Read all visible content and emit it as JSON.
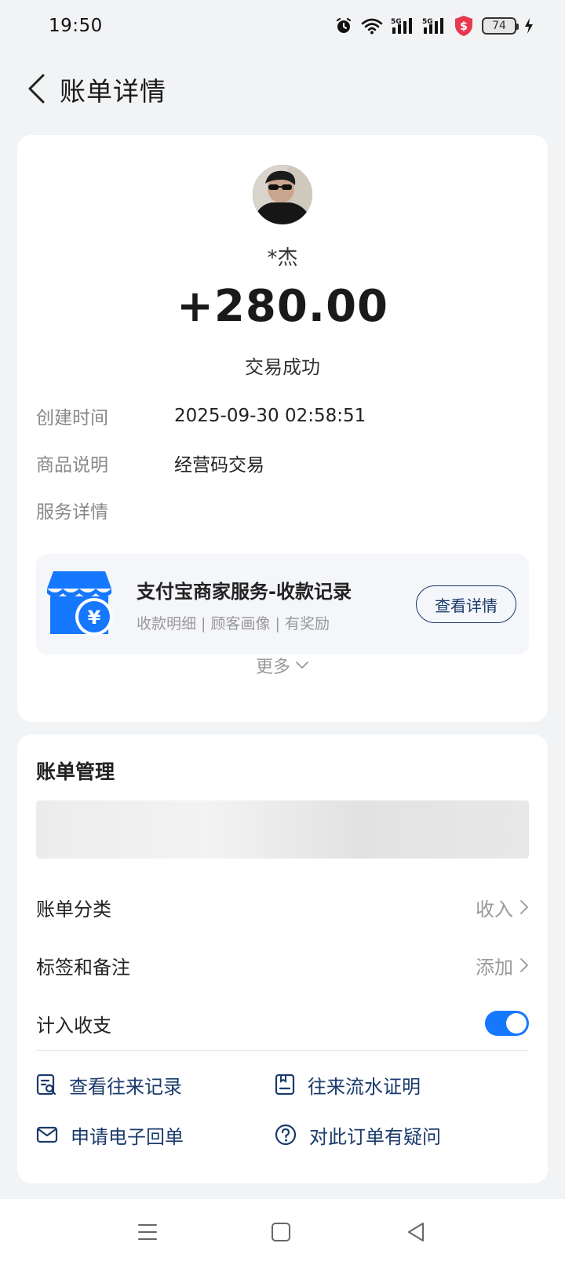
{
  "status_bar": {
    "time": "19:50",
    "battery": "74",
    "icons": [
      "alarm-icon",
      "wifi-icon",
      "signal-5g-icon",
      "signal-5g-icon",
      "security-shield-icon",
      "battery-icon",
      "charging-icon"
    ]
  },
  "header": {
    "back_icon": "chevron-left-icon",
    "title": "账单详情"
  },
  "transaction": {
    "payer_name": "*杰",
    "amount": "+280.00",
    "status": "交易成功",
    "details": [
      {
        "label": "创建时间",
        "value": "2025-09-30 02:58:51"
      },
      {
        "label": "商品说明",
        "value": "经营码交易"
      },
      {
        "label": "服务详情",
        "value": ""
      }
    ]
  },
  "merchant_service": {
    "title": "支付宝商家服务-收款记录",
    "subtitle": "收款明细 | 顾客画像 | 有奖励",
    "button": "查看详情",
    "icon": "store-yuan-icon"
  },
  "more": {
    "label": "更多",
    "icon": "chevron-down-icon"
  },
  "bill_management": {
    "title": "账单管理",
    "rows": [
      {
        "label": "账单分类",
        "value": "收入"
      },
      {
        "label": "标签和备注",
        "value": "添加"
      }
    ],
    "toggle": {
      "label": "计入收支",
      "on": true
    },
    "actions": [
      {
        "label": "查看往来记录",
        "icon": "record-search-icon"
      },
      {
        "label": "往来流水证明",
        "icon": "statement-icon"
      },
      {
        "label": "申请电子回单",
        "icon": "mail-icon"
      },
      {
        "label": "对此订单有疑问",
        "icon": "question-icon"
      }
    ]
  },
  "colors": {
    "accent": "#1677ff",
    "link": "#1a3a6b",
    "background": "#f2f3f5",
    "merchant_icon": "#1677ff"
  },
  "system_nav": [
    "menu-icon",
    "home-icon",
    "back-triangle-icon"
  ]
}
